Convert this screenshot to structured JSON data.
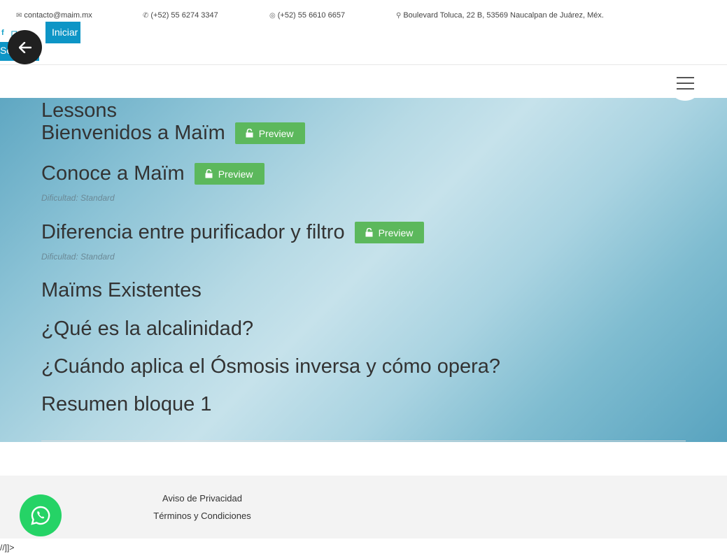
{
  "topbar": {
    "email": "contacto@maim.mx",
    "phone": "(+52) 55 6274 3347",
    "whatsapp": "(+52) 55 6610 6657",
    "address": "Boulevard Toluca, 22 B, 53569 Naucalpan de Juárez, Méx.",
    "login_label": "Iniciar",
    "login_label_2": "Sesión",
    "icons": [
      "envelope-icon",
      "phone-icon",
      "whatsapp-icon",
      "map-marker-icon",
      "facebook-icon",
      "instagram-icon",
      "youtube-icon"
    ]
  },
  "section": {
    "title": "Lessons"
  },
  "lessons": [
    {
      "name": "Bienvenidos a Maïm",
      "preview": "Preview",
      "difficulty": ""
    },
    {
      "name": "Conoce a Maïm",
      "preview": "Preview",
      "difficulty": "Dificultad: Standard"
    },
    {
      "name": "Diferencia entre purificador y filtro",
      "preview": "Preview",
      "difficulty": "Dificultad: Standard"
    },
    {
      "name": "Maïms Existentes"
    },
    {
      "name": "¿Qué es la alcalinidad?"
    },
    {
      "name": "¿Cuándo aplica el Ósmosis inversa y cómo opera?"
    },
    {
      "name": "Resumen bloque 1"
    }
  ],
  "footer": {
    "privacy": "Aviso de Privacidad",
    "terms": "Términos y Condiciones"
  },
  "bottom_text": "//]]>",
  "colors": {
    "brand": "#0d95c6",
    "preview": "#5cb85c",
    "whatsapp": "#25d366"
  }
}
